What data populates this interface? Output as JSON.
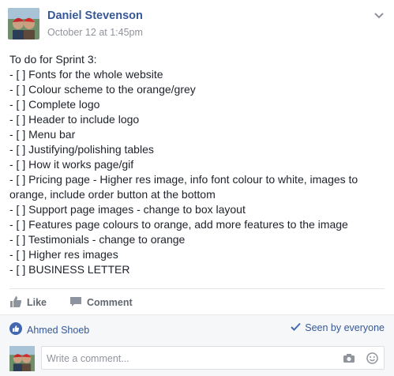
{
  "post": {
    "author": "Daniel Stevenson",
    "timestamp": "October 12 at 1:45pm",
    "lines": [
      "To do for Sprint 3:",
      "- [ ] Fonts for the whole website",
      "- [ ] Colour scheme to the orange/grey",
      "- [ ] Complete logo",
      "- [ ] Header to include logo",
      "- [ ] Menu bar",
      "- [ ] Justifying/polishing tables",
      "- [ ] How it works page/gif",
      "- [ ] Pricing page - Higher res image, info font colour to white, images to orange, include order button at the bottom",
      "- [ ] Support page images - change to box layout",
      "- [ ] Features page colours to orange, add more features to the image",
      "- [ ] Testimonials - change to orange",
      "- [ ] Higher res images",
      "- [ ] BUSINESS LETTER"
    ]
  },
  "actions": {
    "like_label": "Like",
    "comment_label": "Comment"
  },
  "social": {
    "liker_name": "Ahmed Shoeb",
    "seen_label": "Seen by everyone"
  },
  "composer": {
    "placeholder": "Write a comment..."
  },
  "icons": {
    "like": "thumbs-up-icon",
    "comment": "speech-bubble-icon",
    "like_reaction": "like-reaction-icon",
    "seen": "checkmark-icon",
    "camera": "camera-icon",
    "emoji": "emoji-icon",
    "menu": "chevron-down-icon"
  },
  "colors": {
    "link": "#365899",
    "muted": "#90949c",
    "text": "#1d2129",
    "action": "#616770",
    "like_blue": "#4267b2"
  }
}
